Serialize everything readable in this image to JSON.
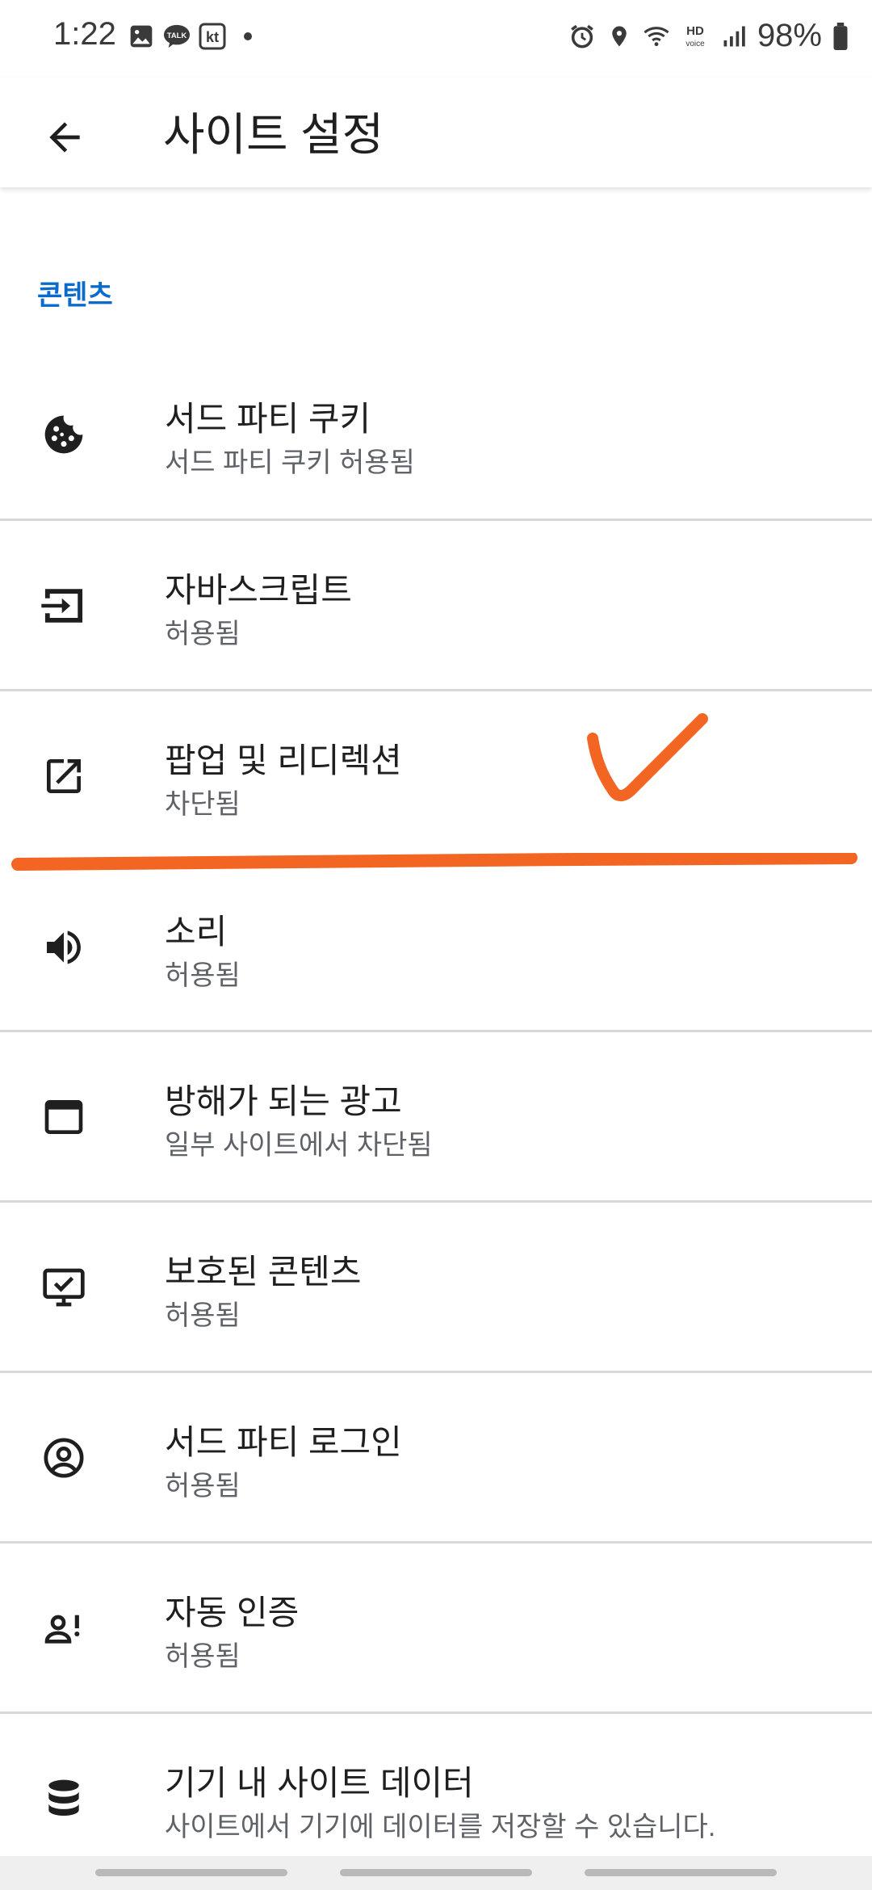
{
  "status_bar": {
    "time": "1:22",
    "left_icons": [
      "gallery-icon",
      "kakaotalk-icon",
      "kt-icon",
      "dot-icon"
    ],
    "right_icons": [
      "alarm-icon",
      "location-icon",
      "wifi-icon",
      "hd-voice-icon",
      "signal-icon",
      "battery-icon"
    ],
    "kakaotalk_label": "TALK",
    "kt_label": "kt",
    "hd_label": "HD",
    "voice_label": "voice",
    "battery": "98%"
  },
  "app_bar": {
    "title": "사이트 설정",
    "back_icon": "arrow-back-icon"
  },
  "section": {
    "header": "콘텐츠"
  },
  "items": [
    {
      "title": "서드 파티 쿠키",
      "subtitle": "서드 파티 쿠키 허용됨",
      "icon": "cookie-icon"
    },
    {
      "title": "자바스크립트",
      "subtitle": "허용됨",
      "icon": "javascript-icon"
    },
    {
      "title": "팝업 및 리디렉션",
      "subtitle": "차단됨",
      "icon": "open-in-new-icon"
    },
    {
      "title": "소리",
      "subtitle": "허용됨",
      "icon": "volume-icon"
    },
    {
      "title": "방해가 되는 광고",
      "subtitle": "일부 사이트에서 차단됨",
      "icon": "ads-window-icon"
    },
    {
      "title": "보호된 콘텐츠",
      "subtitle": "허용됨",
      "icon": "protected-content-icon"
    },
    {
      "title": "서드 파티 로그인",
      "subtitle": "허용됨",
      "icon": "account-circle-icon"
    },
    {
      "title": "자동 인증",
      "subtitle": "허용됨",
      "icon": "auto-verify-icon"
    },
    {
      "title": "기기 내 사이트 데이터",
      "subtitle": "사이트에서 기기에 데이터를 저장할 수 있습니다.",
      "icon": "database-icon"
    }
  ],
  "colors": {
    "section_header": "#0b6bcb",
    "annotation": "#f26522"
  }
}
